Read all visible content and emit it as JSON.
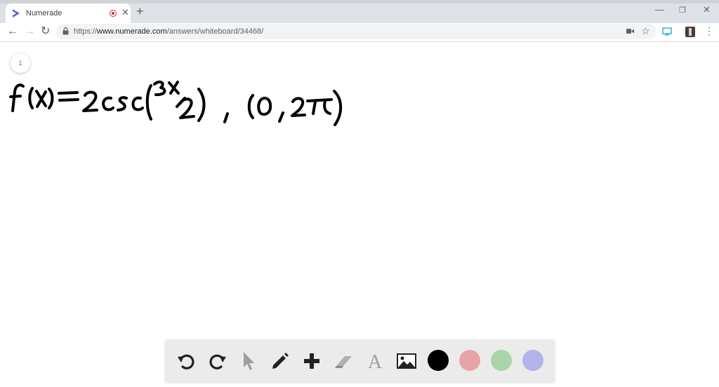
{
  "browser": {
    "tab_title": "Numerade",
    "url_prefix": "https://",
    "url_host": "www.numerade.com",
    "url_path": "/answers/whiteboard/34468/"
  },
  "whiteboard": {
    "page_number": "1",
    "expression": "f(x) = 2csc(3x/2) , (0, 2π)"
  },
  "toolbar": {
    "tools": [
      "undo-icon",
      "redo-icon",
      "pointer-icon",
      "pencil-icon",
      "plus-icon",
      "eraser-icon",
      "text-icon",
      "image-icon"
    ],
    "colors": [
      "#000000",
      "#e8a3a8",
      "#a9d3a9",
      "#b4b2ea"
    ]
  }
}
